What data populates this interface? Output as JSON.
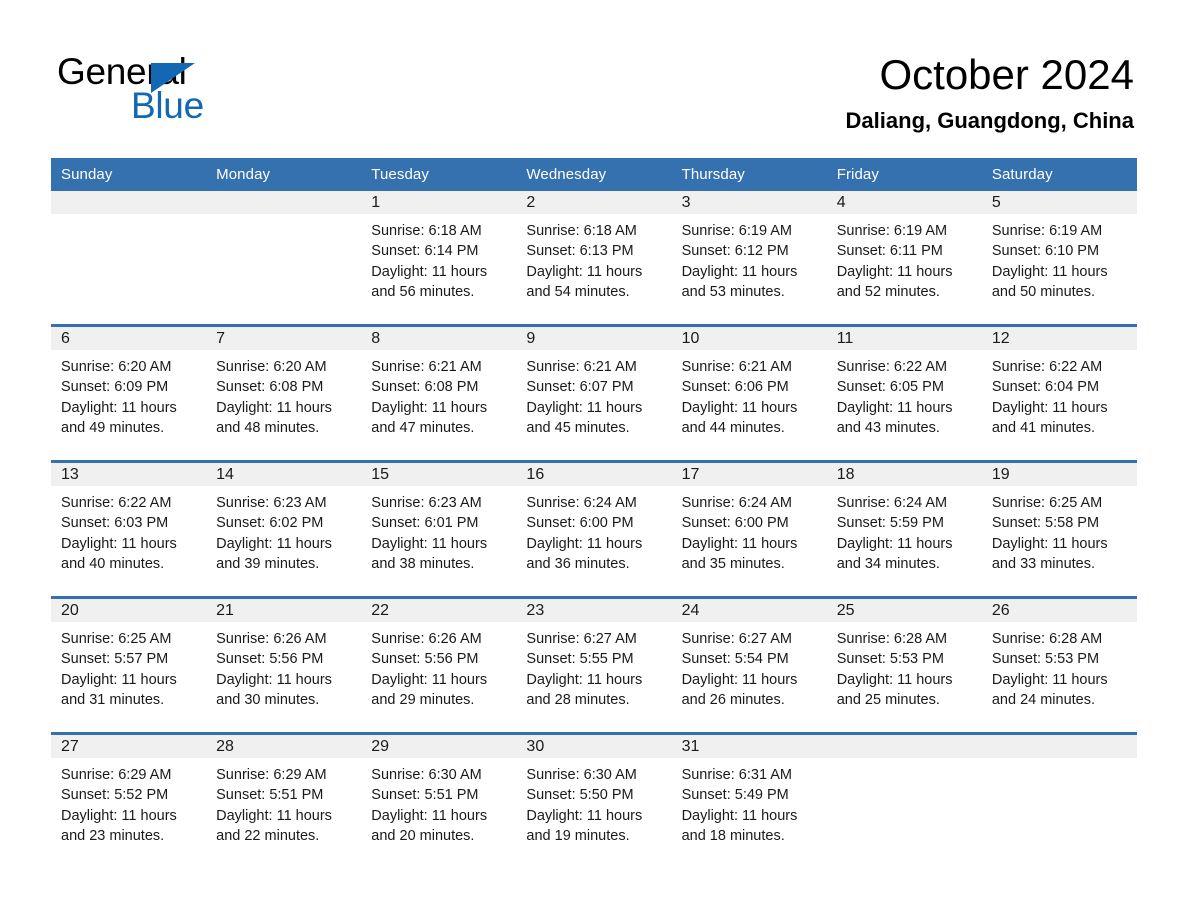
{
  "brand": {
    "name_top": "General",
    "name_bottom": "Blue",
    "accent_color": "#1268b3"
  },
  "header": {
    "month_title": "October 2024",
    "location": "Daliang, Guangdong, China"
  },
  "theme": {
    "header_blue": "#3571ae",
    "daynum_band": "#f0f0f0",
    "text": "#1a1a1a"
  },
  "weekdays": [
    "Sunday",
    "Monday",
    "Tuesday",
    "Wednesday",
    "Thursday",
    "Friday",
    "Saturday"
  ],
  "weeks": [
    [
      {
        "day": "",
        "sunrise": "",
        "sunset": "",
        "daylight_line1": "",
        "daylight_line2": ""
      },
      {
        "day": "",
        "sunrise": "",
        "sunset": "",
        "daylight_line1": "",
        "daylight_line2": ""
      },
      {
        "day": "1",
        "sunrise": "Sunrise: 6:18 AM",
        "sunset": "Sunset: 6:14 PM",
        "daylight_line1": "Daylight: 11 hours",
        "daylight_line2": "and 56 minutes."
      },
      {
        "day": "2",
        "sunrise": "Sunrise: 6:18 AM",
        "sunset": "Sunset: 6:13 PM",
        "daylight_line1": "Daylight: 11 hours",
        "daylight_line2": "and 54 minutes."
      },
      {
        "day": "3",
        "sunrise": "Sunrise: 6:19 AM",
        "sunset": "Sunset: 6:12 PM",
        "daylight_line1": "Daylight: 11 hours",
        "daylight_line2": "and 53 minutes."
      },
      {
        "day": "4",
        "sunrise": "Sunrise: 6:19 AM",
        "sunset": "Sunset: 6:11 PM",
        "daylight_line1": "Daylight: 11 hours",
        "daylight_line2": "and 52 minutes."
      },
      {
        "day": "5",
        "sunrise": "Sunrise: 6:19 AM",
        "sunset": "Sunset: 6:10 PM",
        "daylight_line1": "Daylight: 11 hours",
        "daylight_line2": "and 50 minutes."
      }
    ],
    [
      {
        "day": "6",
        "sunrise": "Sunrise: 6:20 AM",
        "sunset": "Sunset: 6:09 PM",
        "daylight_line1": "Daylight: 11 hours",
        "daylight_line2": "and 49 minutes."
      },
      {
        "day": "7",
        "sunrise": "Sunrise: 6:20 AM",
        "sunset": "Sunset: 6:08 PM",
        "daylight_line1": "Daylight: 11 hours",
        "daylight_line2": "and 48 minutes."
      },
      {
        "day": "8",
        "sunrise": "Sunrise: 6:21 AM",
        "sunset": "Sunset: 6:08 PM",
        "daylight_line1": "Daylight: 11 hours",
        "daylight_line2": "and 47 minutes."
      },
      {
        "day": "9",
        "sunrise": "Sunrise: 6:21 AM",
        "sunset": "Sunset: 6:07 PM",
        "daylight_line1": "Daylight: 11 hours",
        "daylight_line2": "and 45 minutes."
      },
      {
        "day": "10",
        "sunrise": "Sunrise: 6:21 AM",
        "sunset": "Sunset: 6:06 PM",
        "daylight_line1": "Daylight: 11 hours",
        "daylight_line2": "and 44 minutes."
      },
      {
        "day": "11",
        "sunrise": "Sunrise: 6:22 AM",
        "sunset": "Sunset: 6:05 PM",
        "daylight_line1": "Daylight: 11 hours",
        "daylight_line2": "and 43 minutes."
      },
      {
        "day": "12",
        "sunrise": "Sunrise: 6:22 AM",
        "sunset": "Sunset: 6:04 PM",
        "daylight_line1": "Daylight: 11 hours",
        "daylight_line2": "and 41 minutes."
      }
    ],
    [
      {
        "day": "13",
        "sunrise": "Sunrise: 6:22 AM",
        "sunset": "Sunset: 6:03 PM",
        "daylight_line1": "Daylight: 11 hours",
        "daylight_line2": "and 40 minutes."
      },
      {
        "day": "14",
        "sunrise": "Sunrise: 6:23 AM",
        "sunset": "Sunset: 6:02 PM",
        "daylight_line1": "Daylight: 11 hours",
        "daylight_line2": "and 39 minutes."
      },
      {
        "day": "15",
        "sunrise": "Sunrise: 6:23 AM",
        "sunset": "Sunset: 6:01 PM",
        "daylight_line1": "Daylight: 11 hours",
        "daylight_line2": "and 38 minutes."
      },
      {
        "day": "16",
        "sunrise": "Sunrise: 6:24 AM",
        "sunset": "Sunset: 6:00 PM",
        "daylight_line1": "Daylight: 11 hours",
        "daylight_line2": "and 36 minutes."
      },
      {
        "day": "17",
        "sunrise": "Sunrise: 6:24 AM",
        "sunset": "Sunset: 6:00 PM",
        "daylight_line1": "Daylight: 11 hours",
        "daylight_line2": "and 35 minutes."
      },
      {
        "day": "18",
        "sunrise": "Sunrise: 6:24 AM",
        "sunset": "Sunset: 5:59 PM",
        "daylight_line1": "Daylight: 11 hours",
        "daylight_line2": "and 34 minutes."
      },
      {
        "day": "19",
        "sunrise": "Sunrise: 6:25 AM",
        "sunset": "Sunset: 5:58 PM",
        "daylight_line1": "Daylight: 11 hours",
        "daylight_line2": "and 33 minutes."
      }
    ],
    [
      {
        "day": "20",
        "sunrise": "Sunrise: 6:25 AM",
        "sunset": "Sunset: 5:57 PM",
        "daylight_line1": "Daylight: 11 hours",
        "daylight_line2": "and 31 minutes."
      },
      {
        "day": "21",
        "sunrise": "Sunrise: 6:26 AM",
        "sunset": "Sunset: 5:56 PM",
        "daylight_line1": "Daylight: 11 hours",
        "daylight_line2": "and 30 minutes."
      },
      {
        "day": "22",
        "sunrise": "Sunrise: 6:26 AM",
        "sunset": "Sunset: 5:56 PM",
        "daylight_line1": "Daylight: 11 hours",
        "daylight_line2": "and 29 minutes."
      },
      {
        "day": "23",
        "sunrise": "Sunrise: 6:27 AM",
        "sunset": "Sunset: 5:55 PM",
        "daylight_line1": "Daylight: 11 hours",
        "daylight_line2": "and 28 minutes."
      },
      {
        "day": "24",
        "sunrise": "Sunrise: 6:27 AM",
        "sunset": "Sunset: 5:54 PM",
        "daylight_line1": "Daylight: 11 hours",
        "daylight_line2": "and 26 minutes."
      },
      {
        "day": "25",
        "sunrise": "Sunrise: 6:28 AM",
        "sunset": "Sunset: 5:53 PM",
        "daylight_line1": "Daylight: 11 hours",
        "daylight_line2": "and 25 minutes."
      },
      {
        "day": "26",
        "sunrise": "Sunrise: 6:28 AM",
        "sunset": "Sunset: 5:53 PM",
        "daylight_line1": "Daylight: 11 hours",
        "daylight_line2": "and 24 minutes."
      }
    ],
    [
      {
        "day": "27",
        "sunrise": "Sunrise: 6:29 AM",
        "sunset": "Sunset: 5:52 PM",
        "daylight_line1": "Daylight: 11 hours",
        "daylight_line2": "and 23 minutes."
      },
      {
        "day": "28",
        "sunrise": "Sunrise: 6:29 AM",
        "sunset": "Sunset: 5:51 PM",
        "daylight_line1": "Daylight: 11 hours",
        "daylight_line2": "and 22 minutes."
      },
      {
        "day": "29",
        "sunrise": "Sunrise: 6:30 AM",
        "sunset": "Sunset: 5:51 PM",
        "daylight_line1": "Daylight: 11 hours",
        "daylight_line2": "and 20 minutes."
      },
      {
        "day": "30",
        "sunrise": "Sunrise: 6:30 AM",
        "sunset": "Sunset: 5:50 PM",
        "daylight_line1": "Daylight: 11 hours",
        "daylight_line2": "and 19 minutes."
      },
      {
        "day": "31",
        "sunrise": "Sunrise: 6:31 AM",
        "sunset": "Sunset: 5:49 PM",
        "daylight_line1": "Daylight: 11 hours",
        "daylight_line2": "and 18 minutes."
      },
      {
        "day": "",
        "sunrise": "",
        "sunset": "",
        "daylight_line1": "",
        "daylight_line2": ""
      },
      {
        "day": "",
        "sunrise": "",
        "sunset": "",
        "daylight_line1": "",
        "daylight_line2": ""
      }
    ]
  ]
}
